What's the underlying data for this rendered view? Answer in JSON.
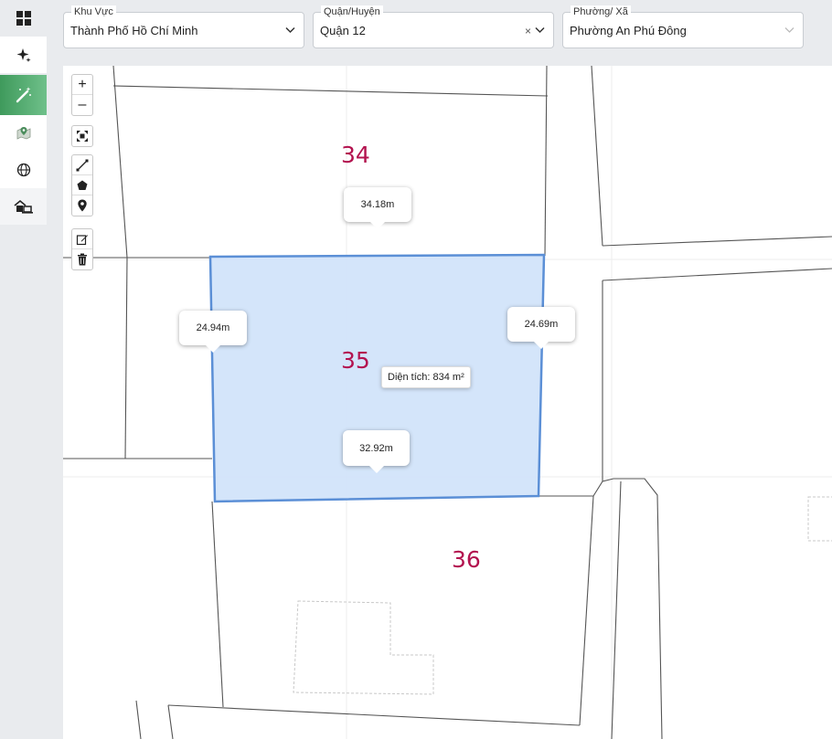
{
  "filters": {
    "khu_vuc": {
      "label": "Khu Vực",
      "value": "Thành Phố Hồ Chí Minh"
    },
    "quan_huyen": {
      "label": "Quận/Huyện",
      "value": "Quận 12",
      "clear": "×"
    },
    "phuong_xa": {
      "label": "Phường/ Xã",
      "value": "Phường An Phú Đông"
    }
  },
  "sidebar": {
    "items": [
      {
        "icon": "grid-icon"
      },
      {
        "icon": "sparkle-icon"
      },
      {
        "icon": "magic-wand-icon",
        "active": true
      },
      {
        "icon": "map-pin-icon"
      },
      {
        "icon": "globe-icon"
      },
      {
        "icon": "house-laptop-icon"
      }
    ]
  },
  "map": {
    "controls": {
      "zoom_in": "+",
      "zoom_out": "–"
    },
    "parcels": [
      {
        "number": "34"
      },
      {
        "number": "35"
      },
      {
        "number": "36"
      }
    ],
    "measurements": {
      "top": "34.18m",
      "left": "24.94m",
      "right": "24.69m",
      "bottom": "32.92m"
    },
    "area_label": "Diện tích: 834 m²",
    "selection_color": "#cfe2fa",
    "selection_stroke": "#5b8fd6",
    "parcel_number_color": "#b3134f"
  }
}
